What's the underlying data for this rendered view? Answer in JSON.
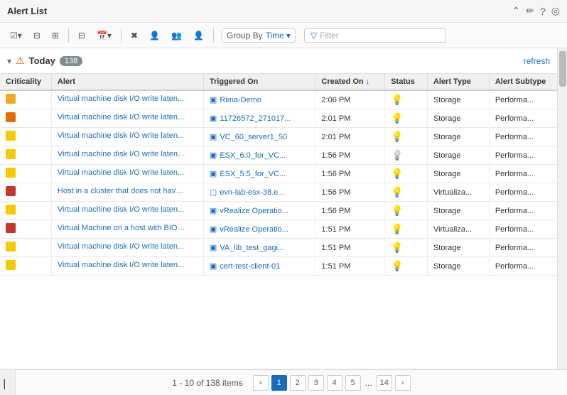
{
  "title": "Alert List",
  "titleIcons": [
    "chevron-up-icon",
    "pencil-icon",
    "question-icon",
    "eye-slash-icon"
  ],
  "toolbar": {
    "groupByLabel": "Group By",
    "groupByValue": "Time",
    "filterPlaceholder": "Filter",
    "buttons": [
      "select-all",
      "collapse-all",
      "expand-all",
      "filter",
      "calendar",
      "clear",
      "user1",
      "user2",
      "user3"
    ]
  },
  "groupHeader": {
    "title": "Today",
    "count": "138",
    "refreshLabel": "refresh"
  },
  "table": {
    "columns": [
      "Criticality",
      "Alert",
      "Triggered On",
      "Created On",
      "Status",
      "Alert Type",
      "Alert Subtype"
    ],
    "sortedColumn": "Created On",
    "sortDirection": "desc",
    "rows": [
      {
        "criticality": "yellow-orange",
        "criticality_color": "#f5a623",
        "alert": "Virtual machine disk I/O write laten...",
        "triggered": "Rima-Demo",
        "created": "2:06 PM",
        "status": "bulb-yellow",
        "alertType": "Storage",
        "alertSubtype": "Performa..."
      },
      {
        "criticality": "orange",
        "criticality_color": "#e07000",
        "alert": "Virtual machine disk I/O write laten...",
        "triggered": "11726572_271017...",
        "created": "2:01 PM",
        "status": "bulb-yellow",
        "alertType": "Storage",
        "alertSubtype": "Performa..."
      },
      {
        "criticality": "yellow",
        "criticality_color": "#f5c800",
        "alert": "Virtual machine disk I/O write laten...",
        "triggered": "VC_60_server1_50",
        "created": "2:01 PM",
        "status": "bulb-yellow",
        "alertType": "Storage",
        "alertSubtype": "Performa..."
      },
      {
        "criticality": "yellow",
        "criticality_color": "#f5c800",
        "alert": "Virtual machine disk I/O write laten...",
        "triggered": "ESX_6.0_for_VC...",
        "created": "1:56 PM",
        "status": "bulb-gray",
        "alertType": "Storage",
        "alertSubtype": "Performa..."
      },
      {
        "criticality": "yellow",
        "criticality_color": "#f5c800",
        "alert": "Virtual machine disk I/O write laten...",
        "triggered": "ESX_5.5_for_VC...",
        "created": "1:56 PM",
        "status": "bulb-yellow",
        "alertType": "Storage",
        "alertSubtype": "Performa..."
      },
      {
        "criticality": "red",
        "criticality_color": "#c0392b",
        "alert": "Host in a cluster that does not have...",
        "triggered": "evn-lab-esx-38.e...",
        "created": "1:56 PM",
        "status": "bulb-yellow",
        "alertType": "Virtualiza...",
        "alertSubtype": "Performa..."
      },
      {
        "criticality": "yellow",
        "criticality_color": "#f5c800",
        "alert": "Virtual machine disk I/O write laten...",
        "triggered": "vRealize Operatio...",
        "created": "1:56 PM",
        "status": "bulb-yellow",
        "alertType": "Storage",
        "alertSubtype": "Performa..."
      },
      {
        "criticality": "red",
        "criticality_color": "#c0392b",
        "alert": "Virtual Machine on a host with BIOS...",
        "triggered": "vRealize Operatio...",
        "created": "1:51 PM",
        "status": "bulb-yellow",
        "alertType": "Virtualiza...",
        "alertSubtype": "Performa..."
      },
      {
        "criticality": "yellow",
        "criticality_color": "#f5c800",
        "alert": "Virtual machine disk I/O write laten...",
        "triggered": "VA_lib_test_gagi...",
        "created": "1:51 PM",
        "status": "bulb-yellow",
        "alertType": "Storage",
        "alertSubtype": "Performa..."
      },
      {
        "criticality": "yellow",
        "criticality_color": "#f5c800",
        "alert": "Virtual machine disk I/O write laten...",
        "triggered": "cert-test-client-01",
        "created": "1:51 PM",
        "status": "bulb-yellow",
        "alertType": "Storage",
        "alertSubtype": "Performa..."
      }
    ]
  },
  "pagination": {
    "info": "1 - 10 of 138 items",
    "pages": [
      "1",
      "2",
      "3",
      "4",
      "5",
      "...",
      "14"
    ],
    "activePage": "1"
  },
  "icons": {
    "chevronUp": "⌃",
    "chevronDown": "▾",
    "pencil": "✏",
    "question": "?",
    "eyeSlash": "◎",
    "filter": "⊟",
    "bulbYellow": "💡",
    "bulbGray": "💡",
    "vmIcon": "▣",
    "hostIcon": "▢",
    "chevronLeft": "‹",
    "chevronRight": "›",
    "expandCollapse": "▾",
    "sidebar": "▏"
  }
}
